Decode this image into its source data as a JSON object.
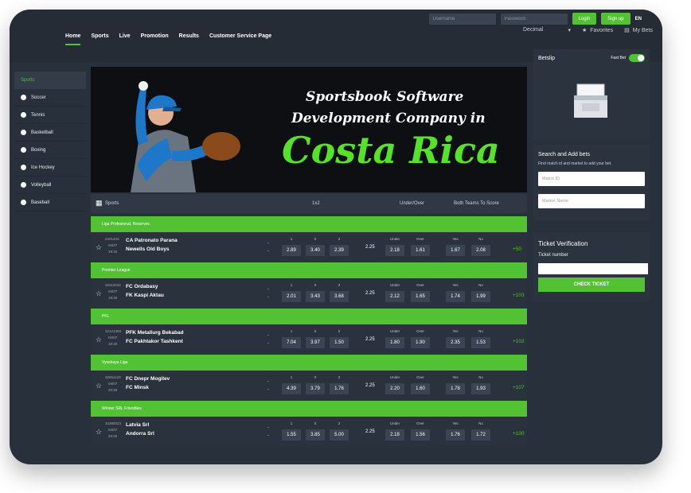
{
  "colors": {
    "accent": "#52c234",
    "banner_green": "#58e12c",
    "background": "#27303b"
  },
  "header": {
    "nav": [
      "Home",
      "Sports",
      "Live",
      "Promotion",
      "Results",
      "Customer Service Page"
    ],
    "username_placeholder": "Username",
    "password_placeholder": "Password",
    "login_label": "Login",
    "signup_label": "Sign up",
    "lang": "EN",
    "odds_format": "Decimal",
    "favorites": "Favorites",
    "my_bets": "My Bets"
  },
  "sidebar": {
    "title": "Sports",
    "items": [
      "Soccer",
      "Tennis",
      "Basketball",
      "Boxing",
      "Ice Hockey",
      "Volleyball",
      "Baseball"
    ]
  },
  "banner": {
    "line1": "Sportsbook Software",
    "line2": "Development Company in",
    "line3": "Costa Rica"
  },
  "table": {
    "sports_label": "Sports",
    "col_1x2": "1x2",
    "col_under_over": "Under/Over",
    "col_btts": "Both Teams To Score",
    "odds_headers": [
      "1",
      "X",
      "2"
    ],
    "uo_headers": [
      "Under",
      "Over"
    ],
    "btts_headers": [
      "Yes",
      "No"
    ]
  },
  "matches": [
    {
      "league": "Liga Profesional, Reserves",
      "id": "2401403",
      "date": "04/07",
      "time": "19:30",
      "home": "CA Patronato Parana",
      "away": "Newells Old Boys",
      "odds": [
        "2.89",
        "3.40",
        "2.39"
      ],
      "line": "2.25",
      "uo": [
        "2.18",
        "1.61"
      ],
      "btts": [
        "1.67",
        "2.08"
      ],
      "more": "+50"
    },
    {
      "league": "Premier League",
      "id": "32112023",
      "date": "04/07",
      "time": "19:30",
      "home": "FC Ordabasy",
      "away": "FK Kaspi Aktau",
      "odds": [
        "2.01",
        "3.43",
        "3.68"
      ],
      "line": "2.25",
      "uo": [
        "2.12",
        "1.65"
      ],
      "btts": [
        "1.74",
        "1.99"
      ],
      "more": "+103"
    },
    {
      "league": "PFL",
      "id": "32121303",
      "date": "04/07",
      "time": "19:30",
      "home": "PFK Metallurg Bekabad",
      "away": "FC Pakhtakor Tashkent",
      "odds": [
        "7.04",
        "3.97",
        "1.50"
      ],
      "line": "2.25",
      "uo": [
        "1.80",
        "1.90"
      ],
      "btts": [
        "2.35",
        "1.53"
      ],
      "more": "+102"
    },
    {
      "league": "Vysshaya Liga",
      "id": "32061123",
      "date": "04/07",
      "time": "20:30",
      "home": "FC Dnepr Mogilev",
      "away": "FC Minsk",
      "odds": [
        "4.39",
        "3.79",
        "1.76"
      ],
      "line": "2.25",
      "uo": [
        "2.20",
        "1.60"
      ],
      "btts": [
        "1.78",
        "1.93"
      ],
      "more": "+107"
    },
    {
      "league": "Winner SRL Friendlies",
      "id": "34380023",
      "date": "04/07",
      "time": "20:30",
      "home": "Latvia Srl",
      "away": "Andorra Srl",
      "odds": [
        "1.55",
        "3.85",
        "5.00"
      ],
      "line": "2.25",
      "uo": [
        "2.18",
        "1.56"
      ],
      "btts": [
        "1.76",
        "1.72"
      ],
      "more": "+100"
    }
  ],
  "betslip": {
    "title": "Betslip",
    "fast_bet": "Fast Bet"
  },
  "search_bets": {
    "title": "Search and Add bets",
    "hint": "Find match id and market to add your bet.",
    "match_id_placeholder": "Match ID",
    "market_placeholder": "Market Name"
  },
  "ticket": {
    "title": "Ticket Verification",
    "label": "Ticket number",
    "button": "CHECK TICKET"
  }
}
